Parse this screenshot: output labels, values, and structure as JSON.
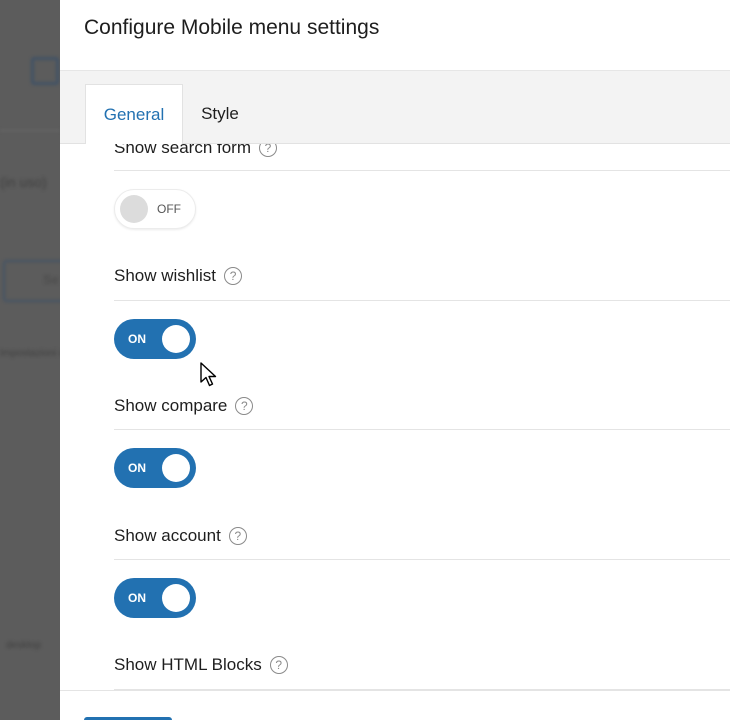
{
  "backdrop": {
    "text_in_uso": "(in uso)",
    "button_label": "Se",
    "text_small": "Impostazioni co",
    "text_desktop": "desktop"
  },
  "modal": {
    "title": "Configure Mobile menu settings",
    "tabs": [
      {
        "label": "General",
        "active": true
      },
      {
        "label": "Style",
        "active": false
      }
    ]
  },
  "settings": [
    {
      "label": "Show search form",
      "help": "?",
      "state": "OFF"
    },
    {
      "label": "Show wishlist",
      "help": "?",
      "state": "ON"
    },
    {
      "label": "Show compare",
      "help": "?",
      "state": "ON"
    },
    {
      "label": "Show account",
      "help": "?",
      "state": "ON"
    },
    {
      "label": "Show HTML Blocks",
      "help": "?"
    }
  ],
  "colors": {
    "accent": "#2271b1",
    "text": "#1e1e1e",
    "toggle_off_knob": "#dcdcdc"
  },
  "icons": {
    "help": "question-circle-icon",
    "cursor": "mouse-pointer-icon"
  }
}
